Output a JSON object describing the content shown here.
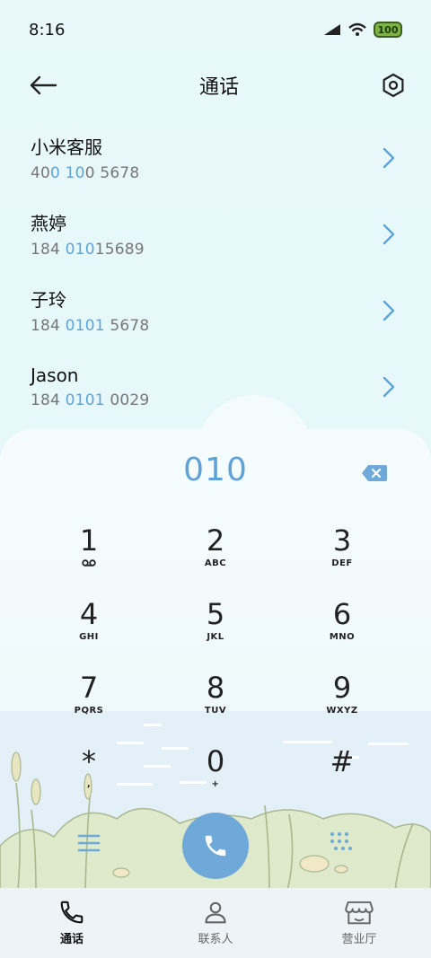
{
  "status_bar": {
    "time": "8:16",
    "battery": "100"
  },
  "header": {
    "title": "通话"
  },
  "contacts": [
    {
      "name": "小米客服",
      "number_parts": [
        "40",
        "0 10",
        "0 5678"
      ]
    },
    {
      "name": "燕婷",
      "number_parts": [
        "184 ",
        "010",
        "15689"
      ]
    },
    {
      "name": "子玲",
      "number_parts": [
        "184 ",
        "0101",
        " 5678"
      ]
    },
    {
      "name": "Jason",
      "number_parts": [
        "184 ",
        "0101",
        " 0029"
      ]
    }
  ],
  "dialer": {
    "input": "010",
    "keys": [
      {
        "digit": "1",
        "letters": ""
      },
      {
        "digit": "2",
        "letters": "ABC"
      },
      {
        "digit": "3",
        "letters": "DEF"
      },
      {
        "digit": "4",
        "letters": "GHI"
      },
      {
        "digit": "5",
        "letters": "JKL"
      },
      {
        "digit": "6",
        "letters": "MNO"
      },
      {
        "digit": "7",
        "letters": "PQRS"
      },
      {
        "digit": "8",
        "letters": "TUV"
      },
      {
        "digit": "9",
        "letters": "WXYZ"
      },
      {
        "digit": "*",
        "letters": ","
      },
      {
        "digit": "0",
        "letters": "+"
      },
      {
        "digit": "#",
        "letters": ""
      }
    ]
  },
  "tabs": [
    {
      "label": "通话",
      "icon": "phone-icon",
      "active": true
    },
    {
      "label": "联系人",
      "icon": "person-icon",
      "active": false
    },
    {
      "label": "营业厅",
      "icon": "store-icon",
      "active": false
    }
  ],
  "colors": {
    "accent": "#5fa3d6",
    "call_button": "#6ea9d9",
    "background": "#e9f9fb"
  }
}
